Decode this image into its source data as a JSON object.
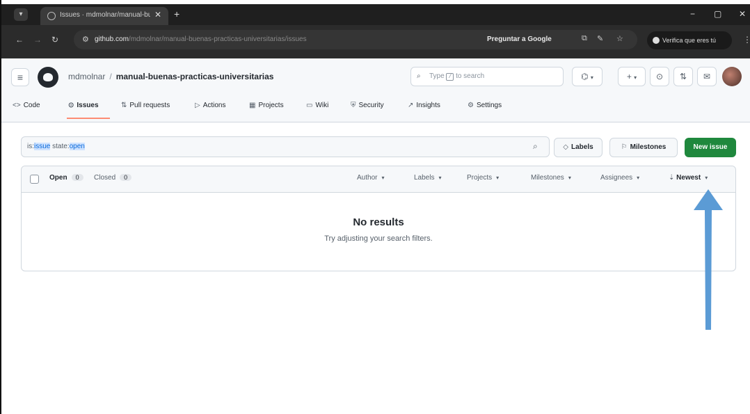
{
  "browser": {
    "tab_title": "Issues · mdmolnar/manual-bu...",
    "tab_close": "✕",
    "new_tab": "+",
    "window_controls": {
      "minimize": "−",
      "maximize": "▢",
      "close": "✕"
    },
    "url_host": "github.com",
    "url_path": "/mdmolnar/manual-buenas-practicas-universitarias/issues",
    "ask_google": "Preguntar a Google",
    "verify_label": "Verifica que eres tú",
    "icons": [
      "tune-icon",
      "lens-icon",
      "translate-icon",
      "star-icon",
      "kebab-icon"
    ]
  },
  "github": {
    "owner": "mdmolnar",
    "separator": "/",
    "repo": "manual-buenas-practicas-universitarias",
    "search_prefix": "Type",
    "search_key": "/",
    "search_suffix": "to search",
    "nav": [
      {
        "icon": "<>",
        "label": "Code"
      },
      {
        "icon": "⊙",
        "label": "Issues"
      },
      {
        "icon": "⇅",
        "label": "Pull requests"
      },
      {
        "icon": "▷",
        "label": "Actions"
      },
      {
        "icon": "▦",
        "label": "Projects"
      },
      {
        "icon": "▭",
        "label": "Wiki"
      },
      {
        "icon": "⛨",
        "label": "Security"
      },
      {
        "icon": "↗",
        "label": "Insights"
      },
      {
        "icon": "⚙",
        "label": "Settings"
      }
    ]
  },
  "issues": {
    "filter_is": "is:",
    "filter_issue": "issue",
    "filter_state": " state:",
    "filter_open": "open",
    "labels_button": "Labels",
    "milestones_button": "Milestones",
    "new_issue_button": "New issue",
    "open_label": "Open",
    "open_count": "0",
    "closed_label": "Closed",
    "closed_count": "0",
    "filters": [
      "Author",
      "Labels",
      "Projects",
      "Milestones",
      "Assignees"
    ],
    "sort_label": "Newest",
    "empty_title": "No results",
    "empty_subtitle": "Try adjusting your search filters."
  },
  "annotation": {
    "arrow_color": "#5b9bd5"
  }
}
